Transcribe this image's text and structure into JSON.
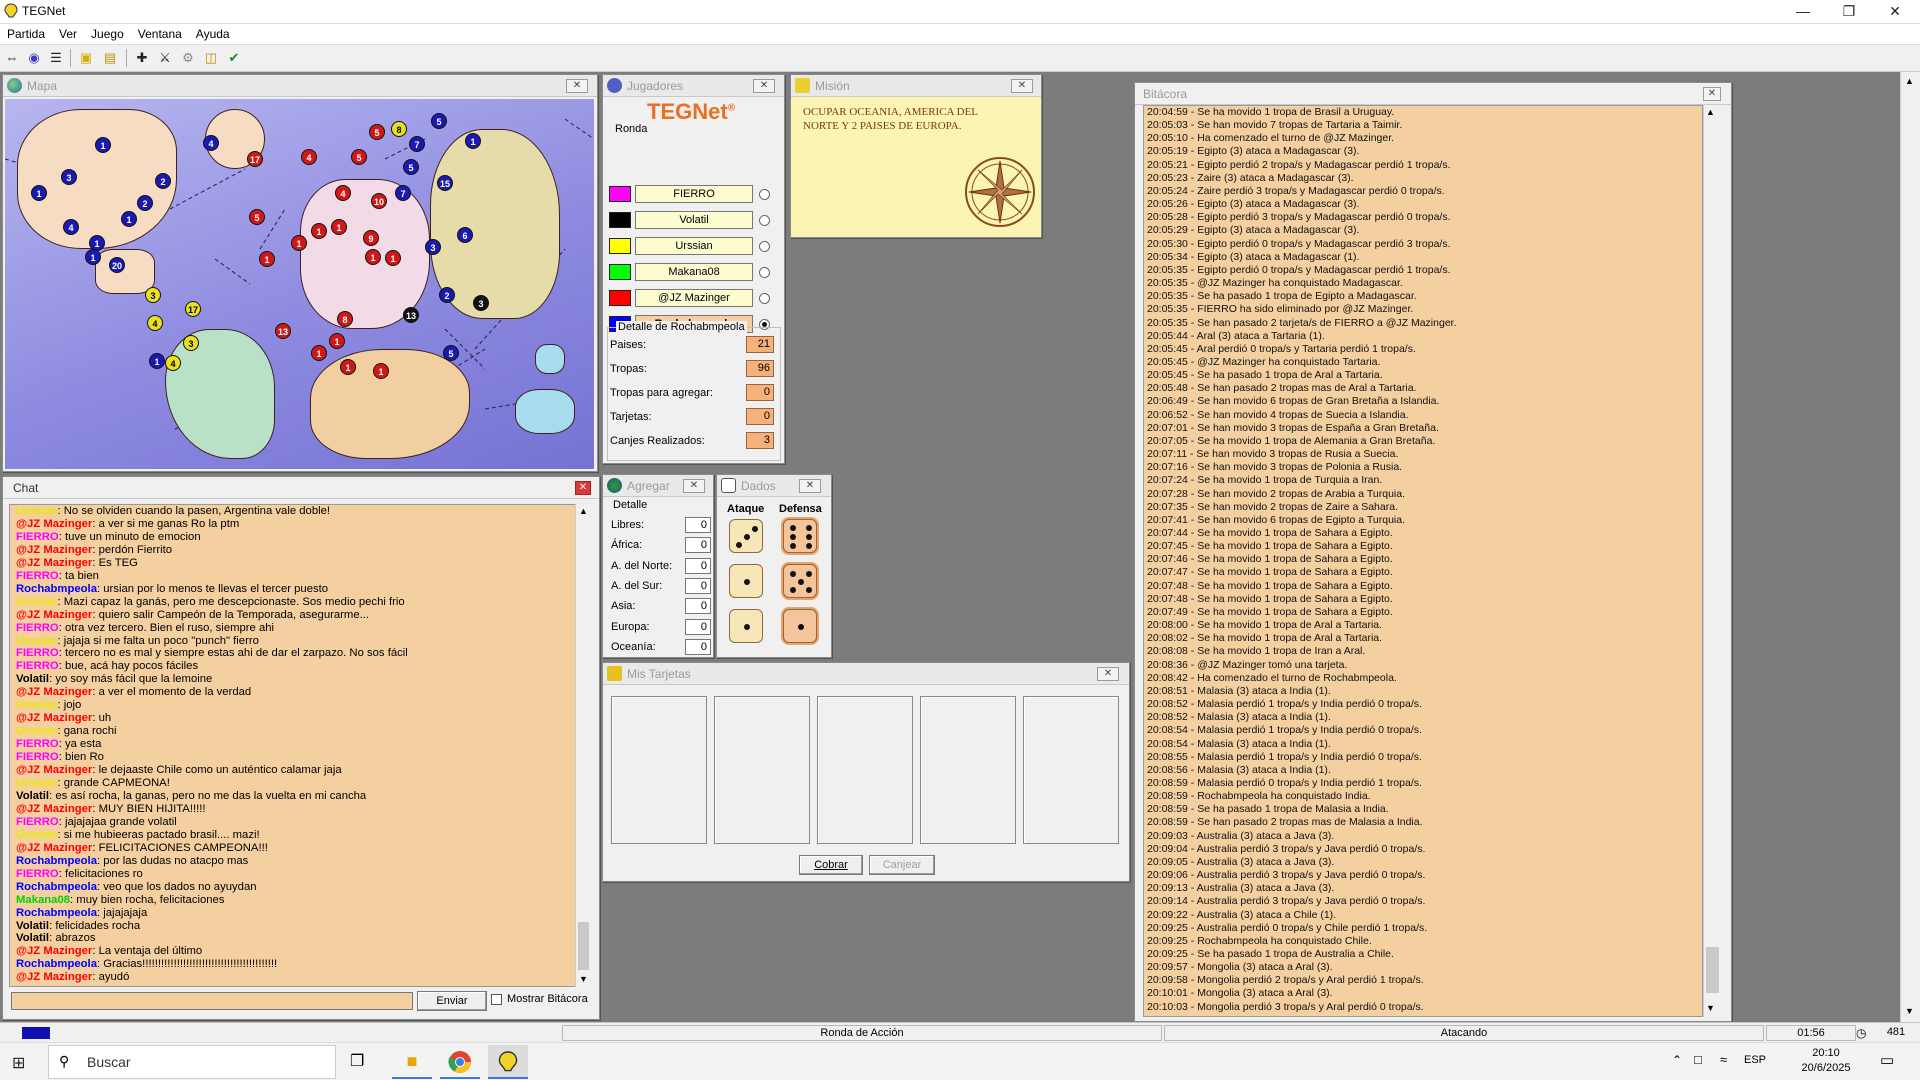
{
  "window": {
    "title": "TEGNet",
    "minimize_icon": "minimize-icon",
    "maximize_icon": "maximize-icon",
    "close_icon": "close-icon"
  },
  "menu": [
    "Partida",
    "Ver",
    "Juego",
    "Ventana",
    "Ayuda"
  ],
  "toolbar_icons": [
    "connect-icon",
    "players-icon",
    "list-icon",
    "card-icon",
    "mission-icon",
    "add-troops-icon",
    "attack-icon",
    "move-icon",
    "cards-icon",
    "end-turn-icon"
  ],
  "map": {
    "title": "Mapa",
    "tokens": [
      {
        "v": "1",
        "c": "blue"
      },
      {
        "v": "3",
        "c": "blue"
      },
      {
        "v": "1",
        "c": "blue"
      },
      {
        "v": "4",
        "c": "blue"
      },
      {
        "v": "1",
        "c": "blue"
      },
      {
        "v": "2",
        "c": "blue"
      },
      {
        "v": "1",
        "c": "blue"
      },
      {
        "v": "2",
        "c": "blue"
      },
      {
        "v": "1",
        "c": "blue"
      },
      {
        "v": "4",
        "c": "blue"
      },
      {
        "v": "20",
        "c": "blue"
      },
      {
        "v": "17",
        "c": "red"
      },
      {
        "v": "5",
        "c": "red"
      },
      {
        "v": "4",
        "c": "red"
      },
      {
        "v": "5",
        "c": "red"
      },
      {
        "v": "4",
        "c": "red"
      },
      {
        "v": "1",
        "c": "red"
      },
      {
        "v": "1",
        "c": "red"
      },
      {
        "v": "1",
        "c": "red"
      },
      {
        "v": "1",
        "c": "red"
      },
      {
        "v": "9",
        "c": "red"
      },
      {
        "v": "10",
        "c": "red"
      },
      {
        "v": "1",
        "c": "red"
      },
      {
        "v": "1",
        "c": "red"
      },
      {
        "v": "5",
        "c": "red"
      },
      {
        "v": "8",
        "c": "yel"
      },
      {
        "v": "5",
        "c": "blue"
      },
      {
        "v": "7",
        "c": "blue"
      },
      {
        "v": "5",
        "c": "blue"
      },
      {
        "v": "15",
        "c": "blue"
      },
      {
        "v": "7",
        "c": "blue"
      },
      {
        "v": "3",
        "c": "blue"
      },
      {
        "v": "6",
        "c": "blue"
      },
      {
        "v": "1",
        "c": "blue"
      },
      {
        "v": "3",
        "c": "yel"
      },
      {
        "v": "17",
        "c": "yel"
      },
      {
        "v": "4",
        "c": "yel"
      },
      {
        "v": "3",
        "c": "yel"
      },
      {
        "v": "4",
        "c": "yel"
      },
      {
        "v": "1",
        "c": "blue"
      },
      {
        "v": "8",
        "c": "red"
      },
      {
        "v": "13",
        "c": "red"
      },
      {
        "v": "1",
        "c": "red"
      },
      {
        "v": "1",
        "c": "red"
      },
      {
        "v": "1",
        "c": "red"
      },
      {
        "v": "1",
        "c": "red"
      },
      {
        "v": "2",
        "c": "blue"
      },
      {
        "v": "13",
        "c": "blk"
      },
      {
        "v": "3",
        "c": "blk"
      },
      {
        "v": "5",
        "c": "blue"
      }
    ]
  },
  "players_panel": {
    "title": "Jugadores",
    "logo": "TEGNet",
    "logo_mark": "®",
    "round_label": "Ronda",
    "players": [
      {
        "name": "FIERRO",
        "color": "#ff00ff",
        "selected": false
      },
      {
        "name": "Volatil",
        "color": "#000000",
        "selected": false
      },
      {
        "name": "Urssian",
        "color": "#ffff00",
        "selected": false
      },
      {
        "name": "Makana08",
        "color": "#00ff00",
        "selected": false
      },
      {
        "name": "@JZ Mazinger",
        "color": "#ff0000",
        "selected": false
      },
      {
        "name": "Rochabmpeola",
        "color": "#0000ff",
        "selected": true
      }
    ],
    "detail_title": "Detalle de Rochabmpeola",
    "details": [
      {
        "label": "Paises:",
        "value": "21"
      },
      {
        "label": "Tropas:",
        "value": "96"
      },
      {
        "label": "Tropas para agregar:",
        "value": "0"
      },
      {
        "label": "Tarjetas:",
        "value": "0"
      },
      {
        "label": "Canjes Realizados:",
        "value": "3"
      }
    ]
  },
  "mission": {
    "title": "Misión",
    "text": "OCUPAR OCEANIA, AMERICA DEL NORTE Y 2 PAISES DE EUROPA.",
    "icon": "compass-rose-icon"
  },
  "chat": {
    "title": "Chat",
    "send_label": "Enviar",
    "show_log_label": "Mostrar Bitácora",
    "input_value": "",
    "lines": [
      {
        "user": "Urssian",
        "color": "#e8e800",
        "text": "No se olviden cuando la pasen, Argentina vale doble!"
      },
      {
        "user": "@JZ Mazinger",
        "color": "#ff0000",
        "text": "a ver si me ganas Ro la ptm"
      },
      {
        "user": "FIERRO",
        "color": "#ff00ff",
        "text": "tuve un minuto de emocion"
      },
      {
        "user": "@JZ Mazinger",
        "color": "#ff0000",
        "text": "perdón Fierrito"
      },
      {
        "user": "@JZ Mazinger",
        "color": "#ff0000",
        "text": "Es TEG"
      },
      {
        "user": "FIERRO",
        "color": "#ff00ff",
        "text": "ta bien"
      },
      {
        "user": "Rochabmpeola",
        "color": "#0000ff",
        "text": "ursian por lo menos te llevas el tercer puesto"
      },
      {
        "user": "Urssian",
        "color": "#e8e800",
        "text": "Mazi capaz la ganás, pero me descepcionaste. Sos medio pechi frio"
      },
      {
        "user": "@JZ Mazinger",
        "color": "#ff0000",
        "text": "quiero salir Campeón de la Temporada, asegurarme..."
      },
      {
        "user": "FIERRO",
        "color": "#ff00ff",
        "text": "otra vez tercero. Bien el ruso, siempre ahi"
      },
      {
        "user": "Urssian",
        "color": "#e8e800",
        "text": "jajaja si me falta un poco \"punch\" fierro"
      },
      {
        "user": "FIERRO",
        "color": "#ff00ff",
        "text": "tercero no es mal y siempre estas ahi de dar el zarpazo. No sos fácil"
      },
      {
        "user": "FIERRO",
        "color": "#ff00ff",
        "text": "bue, acá hay pocos fáciles"
      },
      {
        "user": "Volatil",
        "color": "#000000",
        "text": "yo soy más fácil que la lemoine"
      },
      {
        "user": "@JZ Mazinger",
        "color": "#ff0000",
        "text": "a ver el momento de la verdad"
      },
      {
        "user": "Urssian",
        "color": "#e8e800",
        "text": "jojo"
      },
      {
        "user": "@JZ Mazinger",
        "color": "#ff0000",
        "text": "uh"
      },
      {
        "user": "Urssian",
        "color": "#e8e800",
        "text": "gana rochi"
      },
      {
        "user": "FIERRO",
        "color": "#ff00ff",
        "text": "ya esta"
      },
      {
        "user": "FIERRO",
        "color": "#ff00ff",
        "text": "bien Ro"
      },
      {
        "user": "@JZ Mazinger",
        "color": "#ff0000",
        "text": "le dejaaste Chile como un auténtico calamar jaja"
      },
      {
        "user": "Urssian",
        "color": "#e8e800",
        "text": "grande CAPMEONA!"
      },
      {
        "user": "Volatil",
        "color": "#000000",
        "text": "es así rocha, la ganas, pero no me das la vuelta en mi cancha"
      },
      {
        "user": "@JZ Mazinger",
        "color": "#ff0000",
        "text": "MUY BIEN HIJITA!!!!!"
      },
      {
        "user": "FIERRO",
        "color": "#ff00ff",
        "text": "jajajajaa grande volatil"
      },
      {
        "user": "Urssian",
        "color": "#e8e800",
        "text": "si me hubieeras pactado brasil.... mazi!"
      },
      {
        "user": "@JZ Mazinger",
        "color": "#ff0000",
        "text": "FELICITACIONES CAMPEONA!!!"
      },
      {
        "user": "Rochabmpeola",
        "color": "#0000ff",
        "text": "por las dudas no atacpo mas"
      },
      {
        "user": "FIERRO",
        "color": "#ff00ff",
        "text": "felicitaciones ro"
      },
      {
        "user": "Rochabmpeola",
        "color": "#0000ff",
        "text": "veo que los dados no ayuydan"
      },
      {
        "user": "Makana08",
        "color": "#00d000",
        "text": "muy bien rocha, felicitaciones"
      },
      {
        "user": "Rochabmpeola",
        "color": "#0000ff",
        "text": "jajajajaja"
      },
      {
        "user": "Volatil",
        "color": "#000000",
        "text": "felicidades rocha"
      },
      {
        "user": "Volatil",
        "color": "#000000",
        "text": "abrazos"
      },
      {
        "user": "@JZ Mazinger",
        "color": "#ff0000",
        "text": "La ventaja del último"
      },
      {
        "user": "Rochabmpeola",
        "color": "#0000ff",
        "text": "Gracias!!!!!!!!!!!!!!!!!!!!!!!!!!!!!!!!!!!!!!!!!!!"
      },
      {
        "user": "@JZ Mazinger",
        "color": "#ff0000",
        "text": "ayudó"
      }
    ]
  },
  "add_panel": {
    "title": "Agregar",
    "detail_label": "Detalle",
    "rows": [
      {
        "label": "Libres:",
        "value": "0"
      },
      {
        "label": "África:",
        "value": "0"
      },
      {
        "label": "A. del Norte:",
        "value": "0"
      },
      {
        "label": "A. del Sur:",
        "value": "0"
      },
      {
        "label": "Asia:",
        "value": "0"
      },
      {
        "label": "Europa:",
        "value": "0"
      },
      {
        "label": "Oceanía:",
        "value": "0"
      }
    ]
  },
  "dice": {
    "title": "Dados",
    "attack_label": "Ataque",
    "defense_label": "Defensa",
    "attack": [
      3,
      1,
      1
    ],
    "defense": [
      6,
      5,
      1
    ]
  },
  "cards": {
    "title": "Mis Tarjetas",
    "collect_label": "Cobrar",
    "exchange_label": "Canjear",
    "slots": 5
  },
  "log": {
    "title": "Bitácora",
    "lines": [
      "20:04:59 - Se ha movido 1 tropa de Brasil a Uruguay.",
      "20:05:03 - Se han movido 7 tropas de Tartaria a Taimir.",
      "20:05:10 - Ha comenzado el turno de @JZ Mazinger.",
      "20:05:19 - Egipto (3) ataca a Madagascar (3).",
      "20:05:21 - Egipto perdió 2 tropa/s y Madagascar perdió 1 tropa/s.",
      "20:05:23 - Zaire (3) ataca a Madagascar (3).",
      "20:05:24 - Zaire perdió 3 tropa/s y Madagascar perdió 0 tropa/s.",
      "20:05:26 - Egipto (3) ataca a Madagascar (3).",
      "20:05:28 - Egipto perdió 3 tropa/s y Madagascar perdió 0 tropa/s.",
      "20:05:29 - Egipto (3) ataca a Madagascar (3).",
      "20:05:30 - Egipto perdió 0 tropa/s y Madagascar perdió 3 tropa/s.",
      "20:05:34 - Egipto (3) ataca a Madagascar (1).",
      "20:05:35 - Egipto perdió 0 tropa/s y Madagascar perdió 1 tropa/s.",
      "20:05:35 - @JZ Mazinger ha conquistado Madagascar.",
      "20:05:35 - Se ha pasado 1 tropa de Egipto a Madagascar.",
      "20:05:35 - FIERRO ha sido eliminado por @JZ Mazinger.",
      "20:05:35 - Se han pasado 2 tarjeta/s de FIERRO a @JZ Mazinger.",
      "20:05:44 - Aral (3) ataca a Tartaria (1).",
      "20:05:45 - Aral perdió 0 tropa/s y Tartaria perdió 1 tropa/s.",
      "20:05:45 - @JZ Mazinger ha conquistado Tartaria.",
      "20:05:45 - Se ha pasado 1 tropa de Aral a Tartaria.",
      "20:05:48 - Se han pasado 2 tropas mas de Aral a Tartaria.",
      "20:06:49 - Se han movido 6 tropas de Gran Bretaña a Islandia.",
      "20:06:52 - Se han movido 4 tropas de Suecia a Islandia.",
      "20:07:01 - Se han movido 3 tropas de España a Gran Bretaña.",
      "20:07:05 - Se ha movido 1 tropa de Alemania a Gran Bretaña.",
      "20:07:11 - Se han movido 3 tropas de Rusia a Suecia.",
      "20:07:16 - Se han movido 3 tropas de Polonia a Rusia.",
      "20:07:24 - Se ha movido 1 tropa de Turquia a Iran.",
      "20:07:28 - Se han movido 2 tropas de Arabia a Turquia.",
      "20:07:35 - Se han movido 2 tropas de Zaire a Sahara.",
      "20:07:41 - Se han movido 6 tropas de Egipto a Turquia.",
      "20:07:44 - Se ha movido 1 tropa de Sahara a Egipto.",
      "20:07:45 - Se ha movido 1 tropa de Sahara a Egipto.",
      "20:07:46 - Se ha movido 1 tropa de Sahara a Egipto.",
      "20:07:47 - Se ha movido 1 tropa de Sahara a Egipto.",
      "20:07:48 - Se ha movido 1 tropa de Sahara a Egipto.",
      "20:07:48 - Se ha movido 1 tropa de Sahara a Egipto.",
      "20:07:49 - Se ha movido 1 tropa de Sahara a Egipto.",
      "20:08:00 - Se ha movido 1 tropa de Aral a Tartaria.",
      "20:08:02 - Se ha movido 1 tropa de Aral a Tartaria.",
      "20:08:08 - Se ha movido 1 tropa de Iran a Aral.",
      "20:08:36 - @JZ Mazinger tomó una tarjeta.",
      "20:08:42 - Ha comenzado el turno de Rochabmpeola.",
      "20:08:51 - Malasia (3) ataca a India (1).",
      "20:08:52 - Malasia perdió 1 tropa/s y India perdió 0 tropa/s.",
      "20:08:52 - Malasia (3) ataca a India (1).",
      "20:08:54 - Malasia perdió 1 tropa/s y India perdió 0 tropa/s.",
      "20:08:54 - Malasia (3) ataca a India (1).",
      "20:08:55 - Malasia perdió 1 tropa/s y India perdió 0 tropa/s.",
      "20:08:56 - Malasia (3) ataca a India (1).",
      "20:08:59 - Malasia perdió 0 tropa/s y India perdió 1 tropa/s.",
      "20:08:59 - Rochabmpeola ha conquistado India.",
      "20:08:59 - Se ha pasado 1 tropa de Malasia a India.",
      "20:08:59 - Se han pasado 2 tropas mas de Malasia a India.",
      "20:09:03 - Australia (3) ataca a Java (3).",
      "20:09:04 - Australia perdió 3 tropa/s y Java perdió 0 tropa/s.",
      "20:09:05 - Australia (3) ataca a Java (3).",
      "20:09:06 - Australia perdió 3 tropa/s y Java perdió 0 tropa/s.",
      "20:09:13 - Australia (3) ataca a Java (3).",
      "20:09:14 - Australia perdió 3 tropa/s y Java perdió 0 tropa/s.",
      "20:09:22 - Australia (3) ataca a Chile (1).",
      "20:09:25 - Australia perdió 0 tropa/s y Chile perdió 1 tropa/s.",
      "20:09:25 - Rochabmpeola ha conquistado Chile.",
      "20:09:25 - Se ha pasado 1 tropa de Australia a Chile.",
      "20:09:57 - Mongolia (3) ataca a Aral (3).",
      "20:09:58 - Mongolia perdió 2 tropa/s y Aral perdió 1 tropa/s.",
      "20:10:01 - Mongolia (3) ataca a Aral (3).",
      "20:10:03 - Mongolia perdió 3 tropa/s y Aral perdió 0 tropa/s."
    ]
  },
  "status": {
    "round": "Ronda de Acción",
    "state": "Atacando",
    "time": "01:56",
    "count": "481"
  },
  "taskbar": {
    "search_placeholder": "Buscar",
    "time": "20:10",
    "date": "20/6/2025",
    "lang": "ESP"
  }
}
